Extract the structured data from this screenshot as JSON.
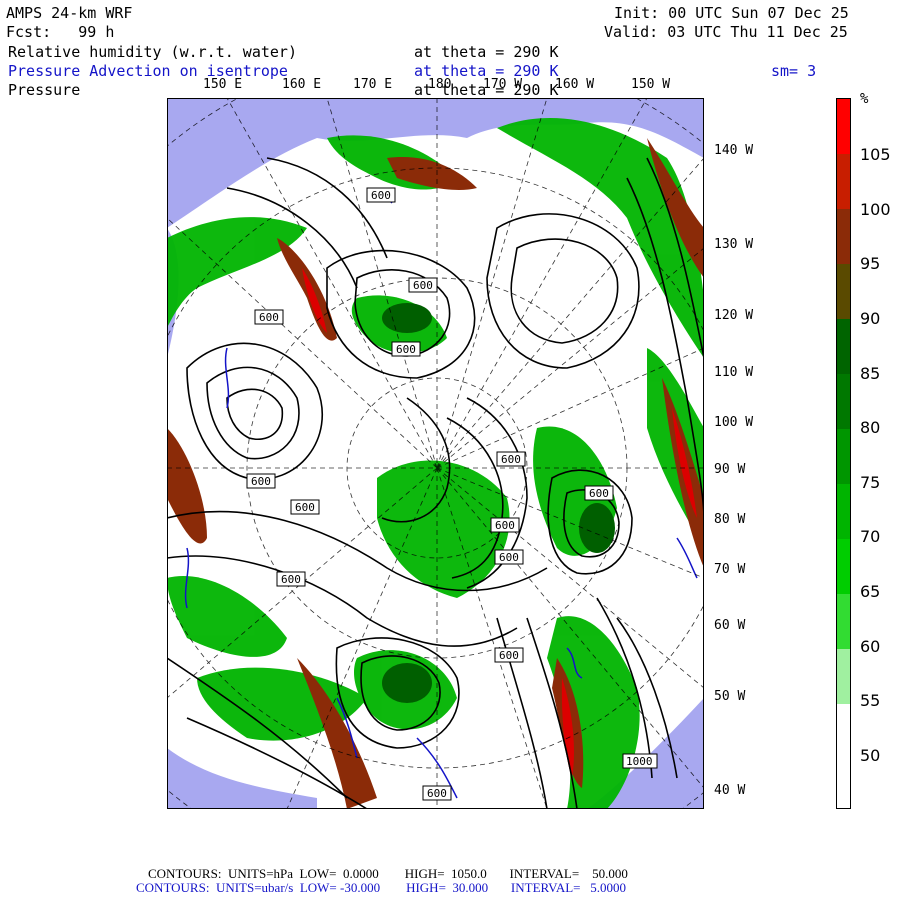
{
  "header": {
    "model": "AMPS 24-km WRF",
    "forecast": "Fcst:   99 h",
    "init": "Init: 00 UTC Sun 07 Dec 25",
    "valid": "Valid: 03 UTC Thu 11 Dec 25"
  },
  "fields": [
    {
      "name": "Relative humidity (w.r.t. water)",
      "level": "at theta = 290 K",
      "color": "#000000"
    },
    {
      "name": "Pressure Advection on isentrope",
      "level": "at theta = 290 K",
      "color": "#1414c8",
      "extra": "sm= 3"
    },
    {
      "name": "Pressure",
      "level": "at theta = 290 K",
      "color": "#000000"
    }
  ],
  "map": {
    "lon_labels_top": [
      "150 E",
      "160 E",
      "170 E",
      "180",
      "170 W",
      "160 W",
      "150 W"
    ],
    "lat_labels_right": [
      "140 W",
      "130 W",
      "120 W",
      "110 W",
      "100 W",
      "90 W",
      "80 W",
      "70 W",
      "60 W",
      "50 W",
      "40 W"
    ],
    "contour_labels": [
      "600",
      "600",
      "600",
      "600",
      "600",
      "600",
      "600",
      "600",
      "600",
      "600",
      "600",
      "1000",
      "600",
      "600"
    ],
    "colors": {
      "ocean": "#a8a8f0",
      "brown": "#8b2b08",
      "red": "#dc0000",
      "green": "#00b400",
      "dark_green": "#005f00"
    }
  },
  "colorbar": {
    "unit": "%",
    "ticks": [
      "105",
      "100",
      "95",
      "90",
      "85",
      "80",
      "75",
      "70",
      "65",
      "60",
      "55",
      "50"
    ],
    "segment_colors": [
      "#ff0000",
      "#c81e00",
      "#8b2b08",
      "#5a4a00",
      "#006400",
      "#007800",
      "#009600",
      "#00b400",
      "#00cd00",
      "#32dc32",
      "#a0f0a0",
      "#ffffff",
      "#ffffff"
    ]
  },
  "footer": {
    "line1": "CONTOURS:  UNITS=hPa  LOW=  0.0000        HIGH=  1050.0       INTERVAL=    50.000",
    "line2": "CONTOURS:  UNITS=ubar/s  LOW= -30.000        HIGH=  30.000       INTERVAL=   5.0000"
  }
}
